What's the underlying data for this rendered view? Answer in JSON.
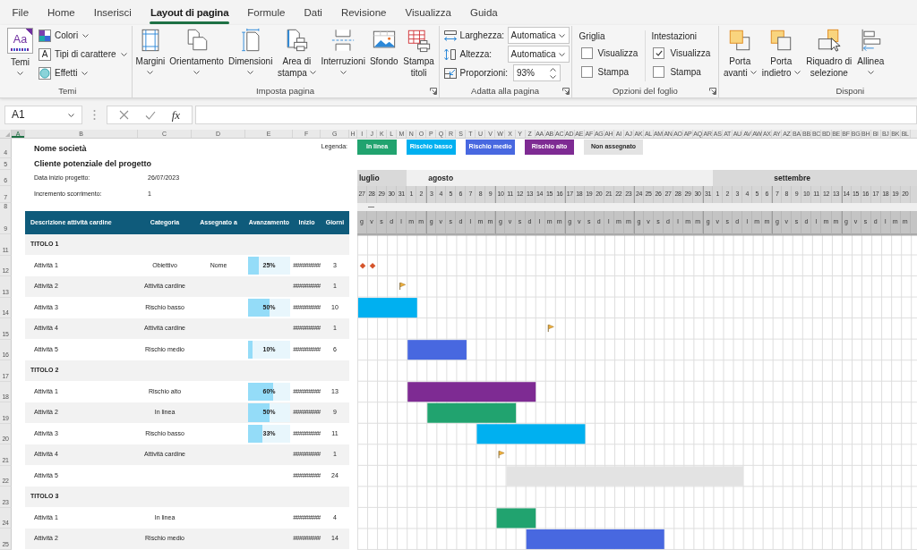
{
  "ribbon": {
    "tabs": [
      {
        "label": "File",
        "selected": false
      },
      {
        "label": "Home",
        "selected": false
      },
      {
        "label": "Inserisci",
        "selected": false
      },
      {
        "label": "Layout di pagina",
        "selected": true
      },
      {
        "label": "Formule",
        "selected": false
      },
      {
        "label": "Dati",
        "selected": false
      },
      {
        "label": "Revisione",
        "selected": false
      },
      {
        "label": "Visualizza",
        "selected": false
      },
      {
        "label": "Guida",
        "selected": false
      }
    ],
    "groups": [
      {
        "label": "Temi",
        "launcher": false,
        "items": [
          {
            "kind": "large",
            "label": "Temi",
            "icon_text": "Aa",
            "dropdown": true
          },
          {
            "kind": "small",
            "label": "Colori",
            "dropdown": true
          },
          {
            "kind": "small",
            "label": "Tipi di carattere",
            "icon_text": "A",
            "dropdown": true
          },
          {
            "kind": "small",
            "label": "Effetti",
            "dropdown": true
          }
        ]
      },
      {
        "label": "Imposta pagina",
        "launcher": true,
        "items": [
          {
            "kind": "large",
            "label": "Margini",
            "dropdown": true
          },
          {
            "kind": "large",
            "label": "Orientamento",
            "dropdown": true
          },
          {
            "kind": "large",
            "label": "Dimensioni",
            "dropdown": true
          },
          {
            "kind": "wrap",
            "label": "Area di stampa",
            "dropdown": true
          },
          {
            "kind": "large",
            "label": "Interruzioni",
            "dropdown": true
          },
          {
            "kind": "large",
            "label": "Sfondo",
            "dropdown": false
          },
          {
            "kind": "wrap",
            "label": "Stampa titoli",
            "dropdown": false
          }
        ]
      },
      {
        "label": "Adatta alla pagina",
        "launcher": true,
        "items": [
          {
            "kind": "select",
            "label": "Larghezza:",
            "value": "Automatica"
          },
          {
            "kind": "select",
            "label": "Altezza:",
            "value": "Automatica"
          },
          {
            "kind": "spinner",
            "label": "Proporzioni:",
            "value": "93%"
          }
        ]
      },
      {
        "label": "Opzioni del foglio",
        "launcher": true,
        "items": [
          {
            "kind": "checklist",
            "heading": "Griglia",
            "options": [
              {
                "label": "Visualizza",
                "checked": false
              },
              {
                "label": "Stampa",
                "checked": false
              }
            ]
          },
          {
            "kind": "checklist",
            "heading": "Intestazioni",
            "options": [
              {
                "label": "Visualizza",
                "checked": true
              },
              {
                "label": "Stampa",
                "checked": false
              }
            ]
          }
        ]
      },
      {
        "label": "Disponi",
        "launcher": false,
        "items": [
          {
            "kind": "wrap",
            "label": "Porta avanti",
            "dropdown": true
          },
          {
            "kind": "wrap",
            "label": "Porta indietro",
            "dropdown": true
          },
          {
            "kind": "wrap",
            "label": "Riquadro di selezione",
            "dropdown": false
          },
          {
            "kind": "large",
            "label": "Allinea",
            "dropdown": true
          }
        ]
      }
    ]
  },
  "formula_bar": {
    "name_box": "A1",
    "function_label": "fx"
  },
  "sheet": {
    "columns": [
      {
        "label": "A",
        "selected": true
      },
      {
        "label": "B",
        "selected": false
      },
      {
        "label": "C",
        "selected": false
      },
      {
        "label": "D",
        "selected": false
      },
      {
        "label": "E",
        "selected": false
      },
      {
        "label": "F",
        "selected": false
      },
      {
        "label": "G",
        "selected": false
      },
      {
        "label": "H",
        "selected": false
      },
      {
        "label": "I",
        "selected": false
      },
      {
        "label": "J",
        "selected": false
      },
      {
        "label": "K",
        "selected": false
      },
      {
        "label": "L",
        "selected": false
      },
      {
        "label": "M",
        "selected": false
      },
      {
        "label": "N",
        "selected": false
      },
      {
        "label": "O",
        "selected": false
      },
      {
        "label": "P",
        "selected": false
      },
      {
        "label": "Q",
        "selected": false
      },
      {
        "label": "R",
        "selected": false
      },
      {
        "label": "S",
        "selected": false
      },
      {
        "label": "T",
        "selected": false
      },
      {
        "label": "U",
        "selected": false
      },
      {
        "label": "V",
        "selected": false
      },
      {
        "label": "W",
        "selected": false
      },
      {
        "label": "X",
        "selected": false
      },
      {
        "label": "Y",
        "selected": false
      },
      {
        "label": "Z",
        "selected": false
      },
      {
        "label": "AA",
        "selected": false
      },
      {
        "label": "AB",
        "selected": false
      },
      {
        "label": "AC",
        "selected": false
      },
      {
        "label": "AD",
        "selected": false
      },
      {
        "label": "AE",
        "selected": false
      },
      {
        "label": "AF",
        "selected": false
      },
      {
        "label": "AG",
        "selected": false
      },
      {
        "label": "AH",
        "selected": false
      },
      {
        "label": "AI",
        "selected": false
      },
      {
        "label": "AJ",
        "selected": false
      },
      {
        "label": "AK",
        "selected": false
      },
      {
        "label": "AL",
        "selected": false
      },
      {
        "label": "AM",
        "selected": false
      },
      {
        "label": "AN",
        "selected": false
      },
      {
        "label": "AO",
        "selected": false
      },
      {
        "label": "AP",
        "selected": false
      },
      {
        "label": "AQ",
        "selected": false
      },
      {
        "label": "AR",
        "selected": false
      },
      {
        "label": "AS",
        "selected": false
      },
      {
        "label": "AT",
        "selected": false
      },
      {
        "label": "AU",
        "selected": false
      },
      {
        "label": "AV",
        "selected": false
      },
      {
        "label": "AW",
        "selected": false
      },
      {
        "label": "AX",
        "selected": false
      },
      {
        "label": "AY",
        "selected": false
      },
      {
        "label": "AZ",
        "selected": false
      },
      {
        "label": "BA",
        "selected": false
      },
      {
        "label": "BB",
        "selected": false
      },
      {
        "label": "BC",
        "selected": false
      },
      {
        "label": "BD",
        "selected": false
      },
      {
        "label": "BE",
        "selected": false
      },
      {
        "label": "BF",
        "selected": false
      },
      {
        "label": "BG",
        "selected": false
      },
      {
        "label": "BH",
        "selected": false
      },
      {
        "label": "BI",
        "selected": false
      },
      {
        "label": "BJ",
        "selected": false
      },
      {
        "label": "BK",
        "selected": false
      },
      {
        "label": "BL",
        "selected": false
      }
    ],
    "row_headers": [
      "4",
      "5",
      "6",
      "7",
      "8",
      "9",
      "11",
      "12",
      "13",
      "14",
      "15",
      "16",
      "17",
      "18",
      "19",
      "20",
      "21",
      "22",
      "23",
      "24",
      "25"
    ],
    "title": "Nome società",
    "subtitle": "Cliente potenziale del progetto",
    "fields": [
      {
        "label": "Data inizio progetto:",
        "value": "26/07/2023"
      },
      {
        "label": "Incremento scorrimento:",
        "value": "1"
      }
    ],
    "legend": {
      "label": "Legenda:",
      "items": [
        {
          "label": "In linea",
          "color": "#21a36f"
        },
        {
          "label": "Rischio basso",
          "color": "#00b0f0"
        },
        {
          "label": "Rischio medio",
          "color": "#4868e0"
        },
        {
          "label": "Rischio alto",
          "color": "#7e2b93"
        },
        {
          "label": "Non assegnato",
          "color": "#e3e3e3"
        }
      ]
    },
    "table": {
      "columns": [
        "Descrizione attività cardine",
        "Categoria",
        "Assegnato a",
        "Avanzamento",
        "Inizio",
        "Giorni"
      ],
      "sections": [
        {
          "title": "TITOLO 1",
          "tasks": [
            {
              "name": "Attività 1",
              "category": "Obiettivo",
              "assignee": "Nome",
              "progress": {
                "level": 0.25,
                "label": "25%"
              },
              "start": "#########",
              "days": "3",
              "kind": "diamond",
              "color": "#d5552b"
            },
            {
              "name": "Attività 2",
              "category": "Attività cardine",
              "start": "#########",
              "days": "1",
              "kind": "flag"
            },
            {
              "name": "Attività 3",
              "category": "Rischio basso",
              "progress": {
                "level": 0.5,
                "label": "50%"
              },
              "start": "#########",
              "days": "10",
              "kind": "bar",
              "color": "#00b0f0"
            },
            {
              "name": "Attività 4",
              "category": "Attività cardine",
              "start": "#########",
              "days": "1",
              "kind": "flag"
            },
            {
              "name": "Attività 5",
              "category": "Rischio medio",
              "progress": {
                "level": 0.1,
                "label": "10%"
              },
              "start": "#########",
              "days": "6",
              "kind": "bar",
              "color": "#4868e0"
            }
          ]
        },
        {
          "title": "TITOLO 2",
          "tasks": [
            {
              "name": "Attività 1",
              "category": "Rischio alto",
              "progress": {
                "level": 0.6,
                "label": "60%"
              },
              "start": "#########",
              "days": "13",
              "kind": "bar",
              "color": "#7e2b93"
            },
            {
              "name": "Attività 2",
              "category": "In linea",
              "progress": {
                "level": 0.5,
                "label": "50%"
              },
              "start": "#########",
              "days": "9",
              "kind": "bar",
              "color": "#21a36f"
            },
            {
              "name": "Attività 3",
              "category": "Rischio basso",
              "progress": {
                "level": 0.33,
                "label": "33%"
              },
              "start": "#########",
              "days": "11",
              "kind": "bar",
              "color": "#00b0f0"
            },
            {
              "name": "Attività 4",
              "category": "Attività cardine",
              "start": "#########",
              "days": "1",
              "kind": "flag"
            },
            {
              "name": "Attività 5",
              "start": "#########",
              "days": "24",
              "kind": "bar",
              "color": "#e3e3e3"
            }
          ]
        },
        {
          "title": "TITOLO 3",
          "tasks": [
            {
              "name": "Attività 1",
              "category": "In linea",
              "start": "#########",
              "days": "4",
              "kind": "bar",
              "color": "#21a36f"
            },
            {
              "name": "Attività 2",
              "category": "Rischio medio",
              "start": "#########",
              "days": "14",
              "kind": "bar",
              "color": "#4868e0"
            }
          ]
        }
      ]
    },
    "gantt": {
      "months": [
        {
          "label": "luglio",
          "days": [
            {
              "date": "27",
              "weekday": "g"
            },
            {
              "date": "28",
              "weekday": "v"
            },
            {
              "date": "29",
              "weekday": "s"
            },
            {
              "date": "30",
              "weekday": "d"
            },
            {
              "date": "31",
              "weekday": "l"
            }
          ]
        },
        {
          "label": "agosto",
          "days": [
            {
              "date": "1",
              "weekday": "m"
            },
            {
              "date": "2",
              "weekday": "m"
            },
            {
              "date": "3",
              "weekday": "g"
            },
            {
              "date": "4",
              "weekday": "v"
            },
            {
              "date": "5",
              "weekday": "s"
            },
            {
              "date": "6",
              "weekday": "d"
            },
            {
              "date": "7",
              "weekday": "l"
            },
            {
              "date": "8",
              "weekday": "m"
            },
            {
              "date": "9",
              "weekday": "m"
            },
            {
              "date": "10",
              "weekday": "g"
            },
            {
              "date": "11",
              "weekday": "v"
            },
            {
              "date": "12",
              "weekday": "s"
            },
            {
              "date": "13",
              "weekday": "d"
            },
            {
              "date": "14",
              "weekday": "l"
            },
            {
              "date": "15",
              "weekday": "m"
            },
            {
              "date": "16",
              "weekday": "m"
            },
            {
              "date": "17",
              "weekday": "g"
            },
            {
              "date": "18",
              "weekday": "v"
            },
            {
              "date": "19",
              "weekday": "s"
            },
            {
              "date": "20",
              "weekday": "d"
            },
            {
              "date": "21",
              "weekday": "l"
            },
            {
              "date": "22",
              "weekday": "m"
            },
            {
              "date": "23",
              "weekday": "m"
            },
            {
              "date": "24",
              "weekday": "g"
            },
            {
              "date": "25",
              "weekday": "v"
            },
            {
              "date": "26",
              "weekday": "s"
            },
            {
              "date": "27",
              "weekday": "d"
            },
            {
              "date": "28",
              "weekday": "l"
            },
            {
              "date": "29",
              "weekday": "m"
            },
            {
              "date": "30",
              "weekday": "m"
            },
            {
              "date": "31",
              "weekday": "g"
            }
          ]
        },
        {
          "label": "settembre",
          "days": [
            {
              "date": "1",
              "weekday": "v"
            },
            {
              "date": "2",
              "weekday": "s"
            },
            {
              "date": "3",
              "weekday": "d"
            },
            {
              "date": "4",
              "weekday": "l"
            },
            {
              "date": "5",
              "weekday": "m"
            },
            {
              "date": "6",
              "weekday": "m"
            },
            {
              "date": "7",
              "weekday": "g"
            },
            {
              "date": "8",
              "weekday": "v"
            },
            {
              "date": "9",
              "weekday": "s"
            },
            {
              "date": "10",
              "weekday": "d"
            },
            {
              "date": "11",
              "weekday": "l"
            },
            {
              "date": "12",
              "weekday": "m"
            },
            {
              "date": "13",
              "weekday": "m"
            },
            {
              "date": "14",
              "weekday": "g"
            },
            {
              "date": "15",
              "weekday": "v"
            },
            {
              "date": "16",
              "weekday": "s"
            },
            {
              "date": "17",
              "weekday": "d"
            },
            {
              "date": "18",
              "weekday": "l"
            },
            {
              "date": "19",
              "weekday": "m"
            },
            {
              "date": "20",
              "weekday": "m"
            }
          ]
        }
      ]
    }
  }
}
